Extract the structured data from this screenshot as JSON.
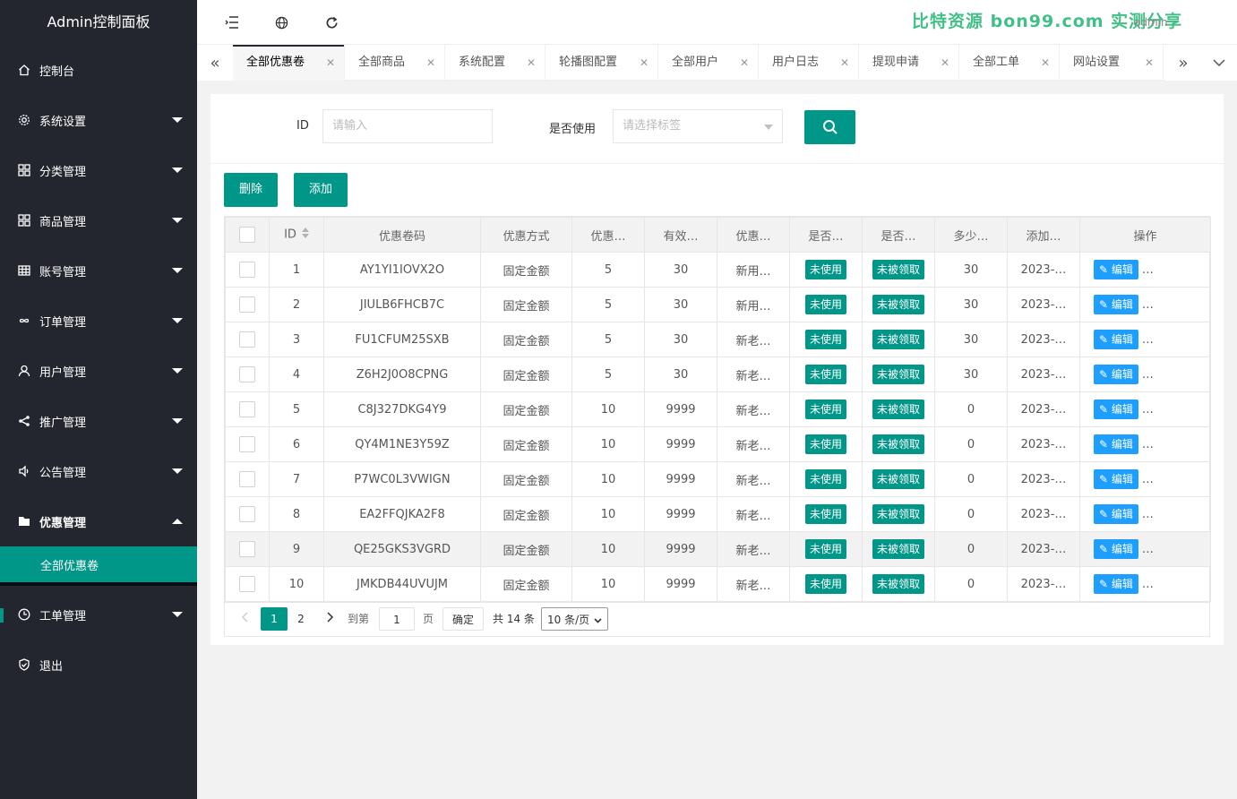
{
  "app": {
    "title": "Admin控制面板"
  },
  "sidebar": {
    "items": [
      {
        "label": "控制台",
        "icon": "home-icon",
        "caret": ""
      },
      {
        "label": "系统设置",
        "icon": "gear-icon",
        "caret": "down"
      },
      {
        "label": "分类管理",
        "icon": "grid-icon",
        "caret": "down"
      },
      {
        "label": "商品管理",
        "icon": "grid-icon",
        "caret": "down"
      },
      {
        "label": "账号管理",
        "icon": "table-icon",
        "caret": "down"
      },
      {
        "label": "订单管理",
        "icon": "infinity-icon",
        "caret": "down"
      },
      {
        "label": "用户管理",
        "icon": "user-icon",
        "caret": "down"
      },
      {
        "label": "推广管理",
        "icon": "share-icon",
        "caret": "down"
      },
      {
        "label": "公告管理",
        "icon": "speaker-icon",
        "caret": "down"
      },
      {
        "label": "优惠管理",
        "icon": "folder-icon",
        "caret": "up"
      }
    ],
    "sub_active": "全部优惠卷",
    "items_after": [
      {
        "label": "工单管理",
        "icon": "clock-icon",
        "caret": "down"
      },
      {
        "label": "退出",
        "icon": "shield-icon",
        "caret": ""
      }
    ]
  },
  "header": {
    "watermark": "比特资源 bon99.com 实测分享",
    "user": "admin"
  },
  "tabs": [
    {
      "label": "全部优惠卷",
      "active": true
    },
    {
      "label": "全部商品"
    },
    {
      "label": "系统配置"
    },
    {
      "label": "轮播图配置"
    },
    {
      "label": "全部用户"
    },
    {
      "label": "用户日志"
    },
    {
      "label": "提现申请"
    },
    {
      "label": "全部工单"
    },
    {
      "label": "网站设置"
    }
  ],
  "search": {
    "id_label": "ID",
    "id_placeholder": "请输入",
    "use_label": "是否使用",
    "use_placeholder": "请选择标签"
  },
  "actions": {
    "delete": "删除",
    "add": "添加"
  },
  "table": {
    "headers": [
      "ID",
      "优惠卷码",
      "优惠方式",
      "优惠…",
      "有效…",
      "优惠…",
      "是否…",
      "是否…",
      "多少…",
      "添加…",
      "操作"
    ],
    "rows": [
      {
        "id": "1",
        "code": "AY1YI1IOVX2O",
        "mode": "固定金额",
        "amount": "5",
        "valid": "30",
        "target": "新用…",
        "used": "未使用",
        "claimed": "未被领取",
        "count": "30",
        "added": "2023-…",
        "edit": "编辑"
      },
      {
        "id": "2",
        "code": "JIULB6FHCB7C",
        "mode": "固定金额",
        "amount": "5",
        "valid": "30",
        "target": "新用…",
        "used": "未使用",
        "claimed": "未被领取",
        "count": "30",
        "added": "2023-…",
        "edit": "编辑"
      },
      {
        "id": "3",
        "code": "FU1CFUM25SXB",
        "mode": "固定金额",
        "amount": "5",
        "valid": "30",
        "target": "新老…",
        "used": "未使用",
        "claimed": "未被领取",
        "count": "30",
        "added": "2023-…",
        "edit": "编辑"
      },
      {
        "id": "4",
        "code": "Z6H2J0O8CPNG",
        "mode": "固定金额",
        "amount": "5",
        "valid": "30",
        "target": "新老…",
        "used": "未使用",
        "claimed": "未被领取",
        "count": "30",
        "added": "2023-…",
        "edit": "编辑"
      },
      {
        "id": "5",
        "code": "C8J327DKG4Y9",
        "mode": "固定金额",
        "amount": "10",
        "valid": "9999",
        "target": "新老…",
        "used": "未使用",
        "claimed": "未被领取",
        "count": "0",
        "added": "2023-…",
        "edit": "编辑"
      },
      {
        "id": "6",
        "code": "QY4M1NE3Y59Z",
        "mode": "固定金额",
        "amount": "10",
        "valid": "9999",
        "target": "新老…",
        "used": "未使用",
        "claimed": "未被领取",
        "count": "0",
        "added": "2023-…",
        "edit": "编辑"
      },
      {
        "id": "7",
        "code": "P7WC0L3VWIGN",
        "mode": "固定金额",
        "amount": "10",
        "valid": "9999",
        "target": "新老…",
        "used": "未使用",
        "claimed": "未被领取",
        "count": "0",
        "added": "2023-…",
        "edit": "编辑"
      },
      {
        "id": "8",
        "code": "EA2FFQJKA2F8",
        "mode": "固定金额",
        "amount": "10",
        "valid": "9999",
        "target": "新老…",
        "used": "未使用",
        "claimed": "未被领取",
        "count": "0",
        "added": "2023-…",
        "edit": "编辑"
      },
      {
        "id": "9",
        "code": "QE25GKS3VGRD",
        "mode": "固定金额",
        "amount": "10",
        "valid": "9999",
        "target": "新老…",
        "used": "未使用",
        "claimed": "未被领取",
        "count": "0",
        "added": "2023-…",
        "edit": "编辑",
        "highlight": true
      },
      {
        "id": "10",
        "code": "JMKDB44UVUJM",
        "mode": "固定金额",
        "amount": "10",
        "valid": "9999",
        "target": "新老…",
        "used": "未使用",
        "claimed": "未被领取",
        "count": "0",
        "added": "2023-…",
        "edit": "编辑"
      }
    ]
  },
  "pager": {
    "page1": "1",
    "page2": "2",
    "goto_label": "到第",
    "goto_value": "1",
    "page_unit": "页",
    "confirm": "确定",
    "total": "共 14 条",
    "per_page": "10 条/页"
  }
}
